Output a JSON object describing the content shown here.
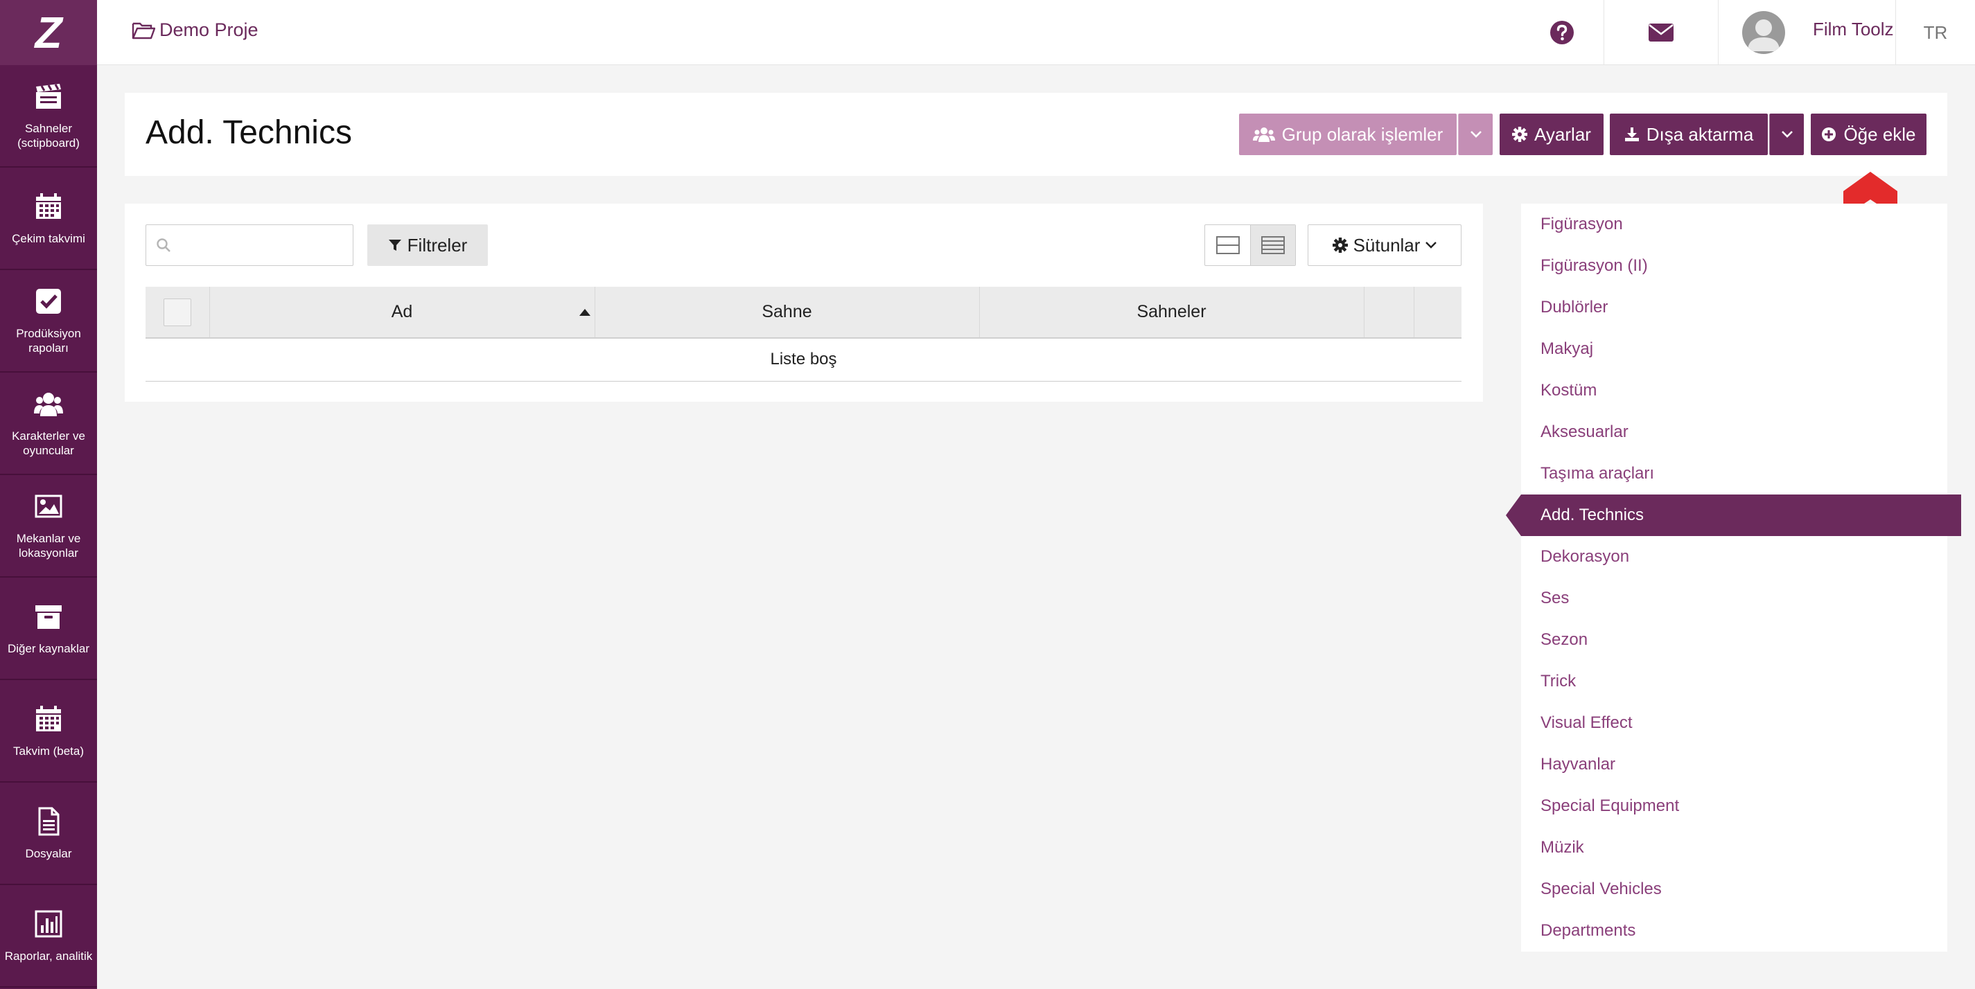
{
  "app": {
    "logo_text": "Z"
  },
  "sidebar": {
    "items": [
      {
        "label": "Sahneler\n(sctipboard)",
        "icon": "clapperboard-icon"
      },
      {
        "label": "Çekim takvimi",
        "icon": "calendar-icon"
      },
      {
        "label": "Prodüksiyon\nrapoları",
        "icon": "checkbox-icon"
      },
      {
        "label": "Karakterler ve\noyuncular",
        "icon": "users-icon"
      },
      {
        "label": "Mekanlar ve\nlokasyonlar",
        "icon": "image-icon"
      },
      {
        "label": "Diğer kaynaklar",
        "icon": "archive-icon"
      },
      {
        "label": "Takvim (beta)",
        "icon": "calendar-icon"
      },
      {
        "label": "Dosyalar",
        "icon": "file-icon"
      },
      {
        "label": "Raporlar, analitik",
        "icon": "bar-chart-icon"
      }
    ]
  },
  "topbar": {
    "project": "Demo Proje",
    "user_name": "Film Toolz",
    "language": "TR",
    "help_icon": "question-circle-icon",
    "mail_icon": "envelope-icon"
  },
  "header": {
    "title": "Add. Technics",
    "group_actions_label": "Grup olarak işlemler",
    "settings_label": "Ayarlar",
    "export_label": "Dışa aktarma",
    "add_item_label": "Öğe ekle"
  },
  "toolbar": {
    "search_placeholder": "",
    "filters_label": "Filtreler",
    "columns_label": "Sütunlar"
  },
  "table": {
    "columns": [
      "Ad",
      "Sahne",
      "Sahneler"
    ],
    "sorted_column": "Ad",
    "empty_message": "Liste boş"
  },
  "categories": {
    "active": "Add. Technics",
    "items": [
      "Figürasyon",
      "Figürasyon (II)",
      "Dublörler",
      "Makyaj",
      "Kostüm",
      "Aksesuarlar",
      "Taşıma araçları",
      "Add. Technics",
      "Dekorasyon",
      "Ses",
      "Sezon",
      "Trick",
      "Visual Effect",
      "Hayvanlar",
      "Special Equipment",
      "Müzik",
      "Special Vehicles",
      "Departments"
    ]
  },
  "colors": {
    "sidebar_bg": "#5b1a4d",
    "accent": "#6b2a5c",
    "accent_light": "#c48fb5",
    "link": "#8a3f7a",
    "scroll_arrow": "#e32b2b"
  }
}
